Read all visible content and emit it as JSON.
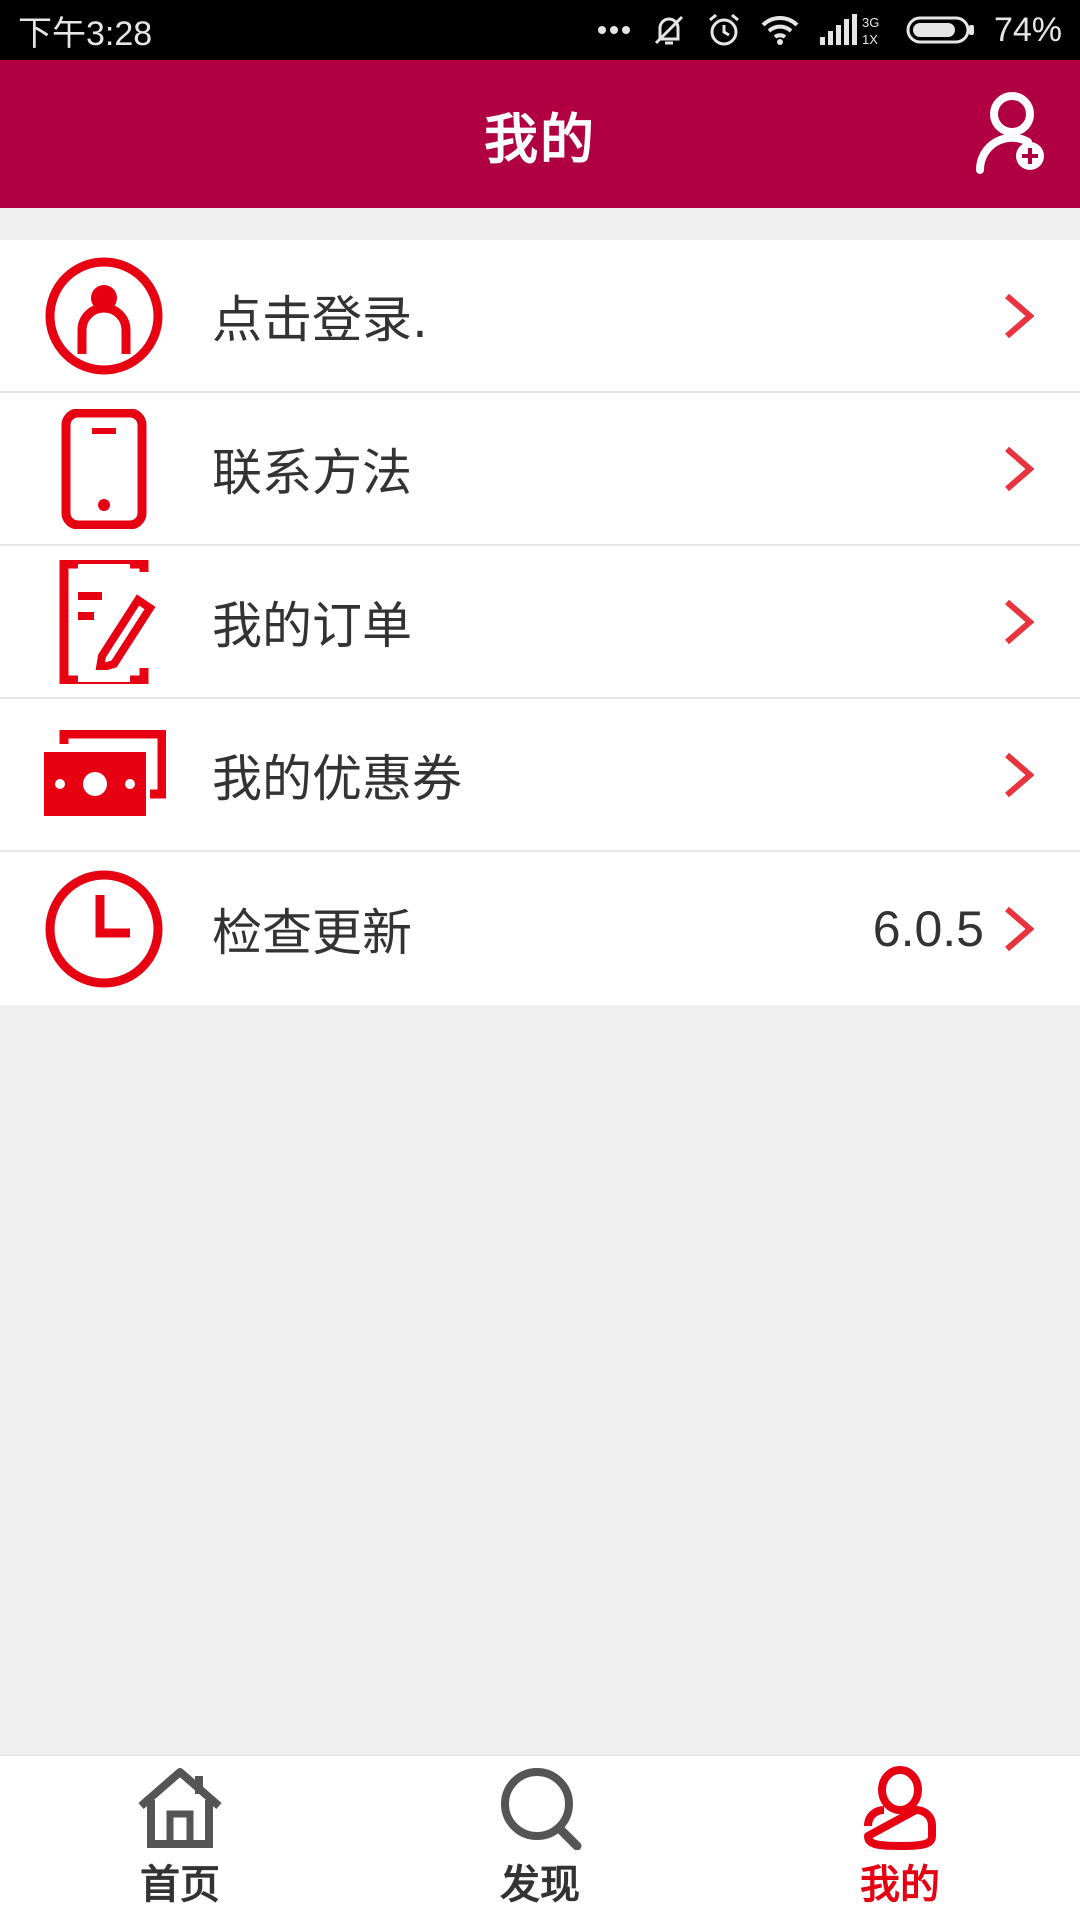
{
  "status_bar": {
    "time": "下午3:28",
    "network_label": "3G\n1X",
    "battery": "74%"
  },
  "header": {
    "title": "我的",
    "icon": "add-user-icon"
  },
  "menu": {
    "items": [
      {
        "label": "点击登录.",
        "icon": "user-circle-icon",
        "value": ""
      },
      {
        "label": "联系方法",
        "icon": "phone-icon",
        "value": ""
      },
      {
        "label": "我的订单",
        "icon": "order-edit-icon",
        "value": ""
      },
      {
        "label": "我的优惠券",
        "icon": "coupon-cash-icon",
        "value": ""
      },
      {
        "label": "检查更新",
        "icon": "clock-icon",
        "value": "6.0.5"
      }
    ]
  },
  "bottom_nav": {
    "items": [
      {
        "label": "首页",
        "icon": "home-icon",
        "active": false
      },
      {
        "label": "发现",
        "icon": "search-icon",
        "active": false
      },
      {
        "label": "我的",
        "icon": "user-icon",
        "active": true
      }
    ]
  },
  "colors": {
    "header": "#b10042",
    "accent": "#e60012",
    "background": "#efefef"
  }
}
